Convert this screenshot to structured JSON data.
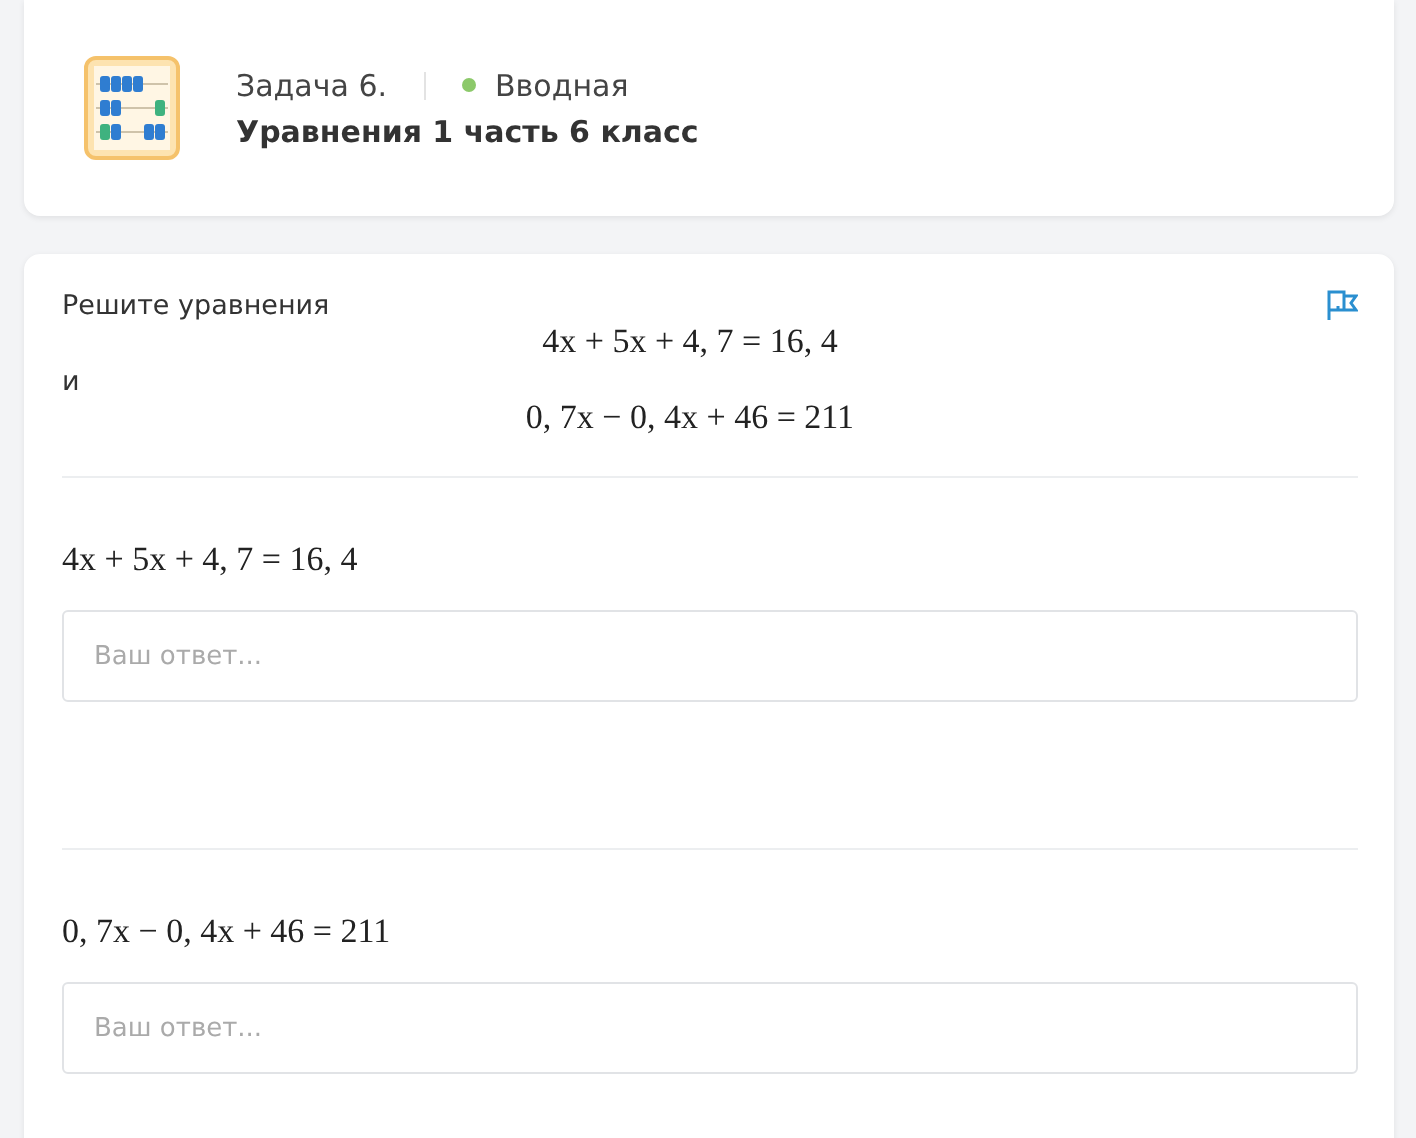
{
  "header": {
    "task_number": "Задача 6.",
    "level": "Вводная",
    "title": "Уравнения 1 часть 6 класс"
  },
  "problem": {
    "intro": "Решите уравнения",
    "equations": [
      "4x + 5x + 4, 7 = 16, 4",
      "0, 7x − 0, 4x + 46 = 211"
    ],
    "conjunction": "и"
  },
  "answers": [
    {
      "equation": "4x + 5x + 4, 7 = 16, 4",
      "placeholder": "Ваш ответ..."
    },
    {
      "equation": "0, 7x − 0, 4x + 46 = 211",
      "placeholder": "Ваш ответ..."
    }
  ]
}
